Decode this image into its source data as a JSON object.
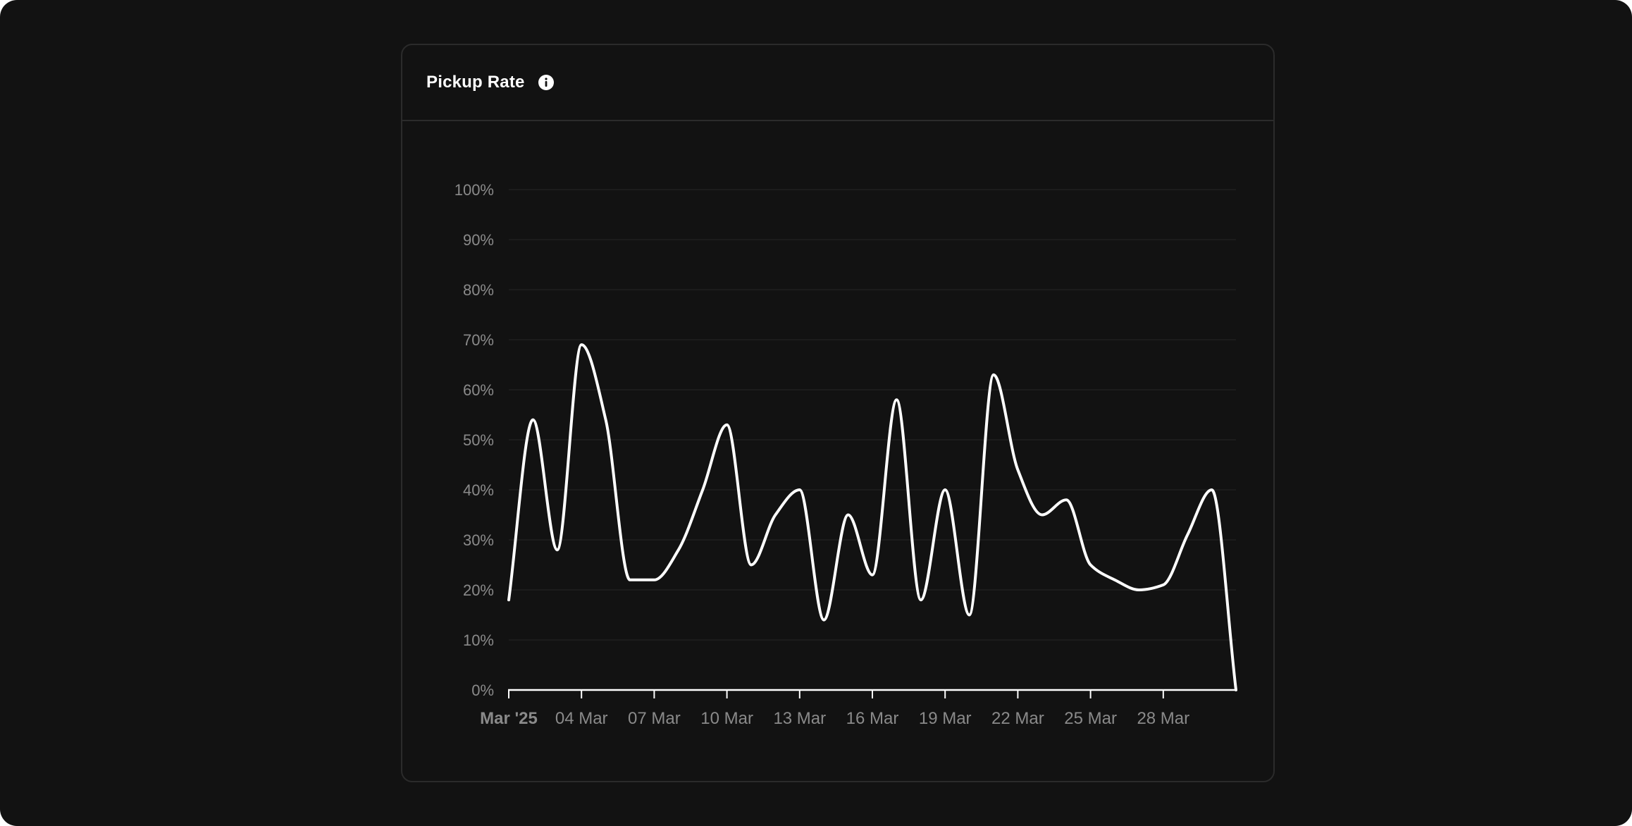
{
  "card": {
    "title": "Pickup Rate",
    "info_icon": "info-icon"
  },
  "colors": {
    "background": "#121212",
    "line": "#ffffff",
    "grid": "#1f1f1f",
    "tick_text": "#8a8a8a",
    "border": "#2b2b2b"
  },
  "chart_data": {
    "type": "line",
    "title": "",
    "xlabel": "",
    "ylabel": "",
    "ylim": [
      0,
      100
    ],
    "y_ticks": [
      "0%",
      "10%",
      "20%",
      "30%",
      "40%",
      "50%",
      "60%",
      "70%",
      "80%",
      "90%",
      "100%"
    ],
    "x_ticks": [
      {
        "date": "2025-03-01",
        "label": "Mar '25"
      },
      {
        "date": "2025-03-04",
        "label": "04 Mar"
      },
      {
        "date": "2025-03-07",
        "label": "07 Mar"
      },
      {
        "date": "2025-03-10",
        "label": "10 Mar"
      },
      {
        "date": "2025-03-13",
        "label": "13 Mar"
      },
      {
        "date": "2025-03-16",
        "label": "16 Mar"
      },
      {
        "date": "2025-03-19",
        "label": "19 Mar"
      },
      {
        "date": "2025-03-22",
        "label": "22 Mar"
      },
      {
        "date": "2025-03-25",
        "label": "25 Mar"
      },
      {
        "date": "2025-03-28",
        "label": "28 Mar"
      }
    ],
    "x_range": [
      "2025-03-01",
      "2025-03-31"
    ],
    "grid": true,
    "legend": "none",
    "series": [
      {
        "x": [
          "2025-03-01",
          "2025-03-02",
          "2025-03-03",
          "2025-03-04",
          "2025-03-05",
          "2025-03-06",
          "2025-03-07",
          "2025-03-08",
          "2025-03-09",
          "2025-03-10",
          "2025-03-11",
          "2025-03-12",
          "2025-03-13",
          "2025-03-14",
          "2025-03-15",
          "2025-03-16",
          "2025-03-17",
          "2025-03-18",
          "2025-03-19",
          "2025-03-20",
          "2025-03-21",
          "2025-03-22",
          "2025-03-23",
          "2025-03-24",
          "2025-03-25",
          "2025-03-26",
          "2025-03-27",
          "2025-03-28",
          "2025-03-29",
          "2025-03-30",
          "2025-03-31"
        ],
        "values": [
          18,
          54,
          28,
          69,
          54,
          22,
          22,
          28,
          40,
          53,
          25,
          35,
          40,
          14,
          35,
          23,
          58,
          18,
          40,
          15,
          63,
          44,
          35,
          38,
          25,
          22,
          20,
          21,
          31,
          40,
          0
        ]
      }
    ]
  }
}
